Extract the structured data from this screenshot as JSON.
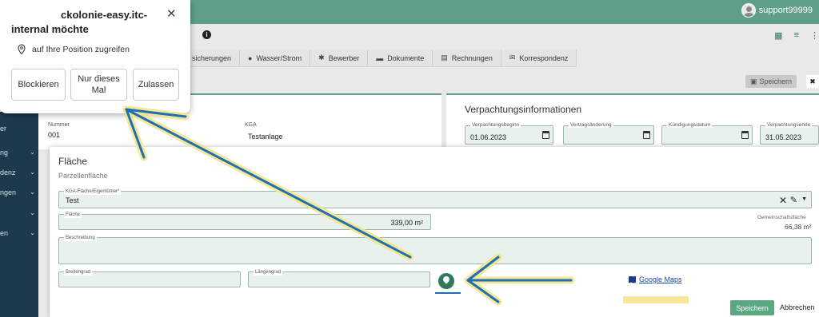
{
  "topbar": {
    "username": "support99999"
  },
  "sidebar": {
    "items": [
      {
        "label": "er",
        "chevron": false
      },
      {
        "label": "ng",
        "chevron": true
      },
      {
        "label": "denz",
        "chevron": true
      },
      {
        "label": "ngen",
        "chevron": true
      },
      {
        "label": "",
        "chevron": true
      },
      {
        "label": "en",
        "chevron": true
      }
    ]
  },
  "tabs": [
    {
      "label": "sicherungen",
      "icon": "insurance-icon"
    },
    {
      "label": "Wasser/Strom",
      "icon": "water-icon"
    },
    {
      "label": "Bewerber",
      "icon": "person-icon"
    },
    {
      "label": "Dokumente",
      "icon": "folder-icon"
    },
    {
      "label": "Rechnungen",
      "icon": "invoice-icon"
    },
    {
      "label": "Korrespondenz",
      "icon": "mail-icon"
    }
  ],
  "toolbar": {
    "save_label": "Speichern",
    "info_symbol": "i"
  },
  "left_panel": {
    "nummer_label": "Nummer",
    "nummer_value": "001",
    "kga_label": "KGA",
    "kga_value": "Testanlage"
  },
  "right_panel": {
    "title": "Verpachtungsinformationen",
    "fields": [
      {
        "label": "Verpachtungsbeginn",
        "value": "01.06.2023"
      },
      {
        "label": "Vertragsänderung",
        "value": ""
      },
      {
        "label": "Kündigungsdatum",
        "value": ""
      },
      {
        "label": "Verpachtungsende",
        "value": "31.05.2023"
      }
    ]
  },
  "popup": {
    "title": "ckolonie-easy.itc-internal möchte",
    "permission": "auf Ihre Position zugreifen",
    "buttons": {
      "block": "Blockieren",
      "once": "Nur dieses Mal",
      "allow": "Zulassen"
    },
    "close_symbol": "✕"
  },
  "dialog": {
    "title": "Fläche",
    "subtitle": "Parzellenfläche",
    "owner_label": "KGA-Fläche/Eigentümer*",
    "owner_value": "Test",
    "area_label": "Fläche",
    "area_value": "339,00 m²",
    "common_label": "Gemeinschaftsfläche",
    "common_value": "66,38 m²",
    "description_label": "Beschreibung",
    "description_value": "",
    "lat_label": "Breitengrad",
    "lat_value": "",
    "lng_label": "Längengrad",
    "lng_value": "",
    "maps_link": "Google Maps",
    "save_label": "Speichern",
    "cancel_label": "Abbrechen"
  },
  "colors": {
    "accent": "#5f9f86",
    "dark": "#1d3a4c",
    "link": "#1a4aa6",
    "highlight": "#f7e79a",
    "arrow": "#1e6fb6"
  }
}
